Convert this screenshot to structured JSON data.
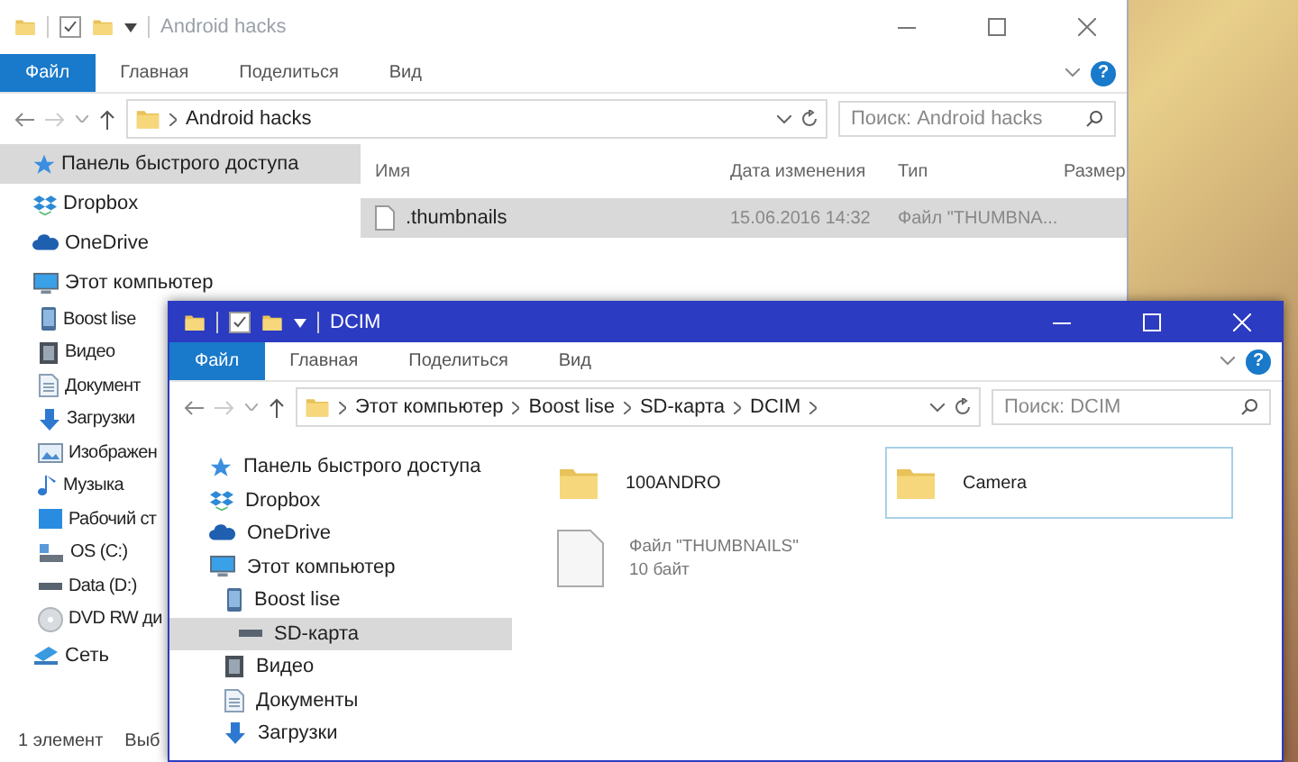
{
  "back_window": {
    "title": "Android hacks",
    "active": false,
    "ribbon_tabs": [
      {
        "label": "Файл",
        "selected": true
      },
      {
        "label": "Главная",
        "selected": false
      },
      {
        "label": "Поделиться",
        "selected": false
      },
      {
        "label": "Вид",
        "selected": false
      }
    ],
    "help_glyph": "?",
    "address": {
      "crumbs": [
        "Android hacks"
      ],
      "trailing_chevron": false
    },
    "search": {
      "placeholder": "Поиск: Android hacks"
    },
    "nav": [
      {
        "label": "Панель быстрого доступа",
        "kind": "star",
        "selected": true
      },
      {
        "label": "Dropbox",
        "kind": "dropbox",
        "selected": false
      },
      {
        "label": "OneDrive",
        "kind": "cloud",
        "selected": false
      },
      {
        "label": "Этот компьютер",
        "kind": "pc",
        "selected": false,
        "children": [
          {
            "label": "Boost lise",
            "kind": "phone",
            "selected": false
          },
          {
            "label": "Видео",
            "kind": "video",
            "selected": false
          },
          {
            "label": "Документ",
            "kind": "docs",
            "selected": false
          },
          {
            "label": "Загрузки",
            "kind": "download",
            "selected": false
          },
          {
            "label": "Изображен",
            "kind": "pictures",
            "selected": false
          },
          {
            "label": "Музыка",
            "kind": "music",
            "selected": false
          },
          {
            "label": "Рабочий ст",
            "kind": "desktop",
            "selected": false
          },
          {
            "label": "OS (C:)",
            "kind": "drive",
            "selected": false
          },
          {
            "label": "Data (D:)",
            "kind": "disk",
            "selected": false
          },
          {
            "label": "DVD RW ди",
            "kind": "dvd",
            "selected": false
          }
        ]
      },
      {
        "label": "Сеть",
        "kind": "network",
        "selected": false
      }
    ],
    "columns": [
      "Имя",
      "Дата изменения",
      "Тип",
      "Размер"
    ],
    "rows": [
      {
        "name": ".thumbnails",
        "date": "15.06.2016 14:32",
        "type": "Файл \"THUMBNA...",
        "selected": true
      }
    ],
    "status_bar": [
      "1 элемент",
      "Выб"
    ]
  },
  "front_window": {
    "title": "DCIM",
    "active": true,
    "ribbon_tabs": [
      {
        "label": "Файл",
        "selected": true
      },
      {
        "label": "Главная",
        "selected": false
      },
      {
        "label": "Поделиться",
        "selected": false
      },
      {
        "label": "Вид",
        "selected": false
      }
    ],
    "help_glyph": "?",
    "address": {
      "crumbs": [
        "Этот компьютер",
        "Boost lise",
        "SD-карта",
        "DCIM"
      ],
      "trailing_chevron": true
    },
    "search": {
      "placeholder": "Поиск: DCIM"
    },
    "nav": [
      {
        "label": "Панель быстрого доступа",
        "kind": "star",
        "selected": false
      },
      {
        "label": "Dropbox",
        "kind": "dropbox",
        "selected": false
      },
      {
        "label": "OneDrive",
        "kind": "cloud",
        "selected": false
      },
      {
        "label": "Этот компьютер",
        "kind": "pc",
        "selected": false,
        "children": [
          {
            "label": "Boost lise",
            "kind": "phone",
            "selected": false,
            "children": [
              {
                "label": "SD-карта",
                "kind": "disk",
                "selected": true
              }
            ]
          },
          {
            "label": "Видео",
            "kind": "video",
            "selected": false
          },
          {
            "label": "Документы",
            "kind": "docs",
            "selected": false
          },
          {
            "label": "Загрузки",
            "kind": "download",
            "selected": false
          }
        ]
      }
    ],
    "tiles": [
      {
        "kind": "folder",
        "name": "100ANDRO",
        "selected": false
      },
      {
        "kind": "folder",
        "name": "Camera",
        "selected": true
      },
      {
        "kind": "file",
        "name": "Файл \"THUMBNAILS\"",
        "size": "10 байт",
        "selected": false
      }
    ]
  }
}
